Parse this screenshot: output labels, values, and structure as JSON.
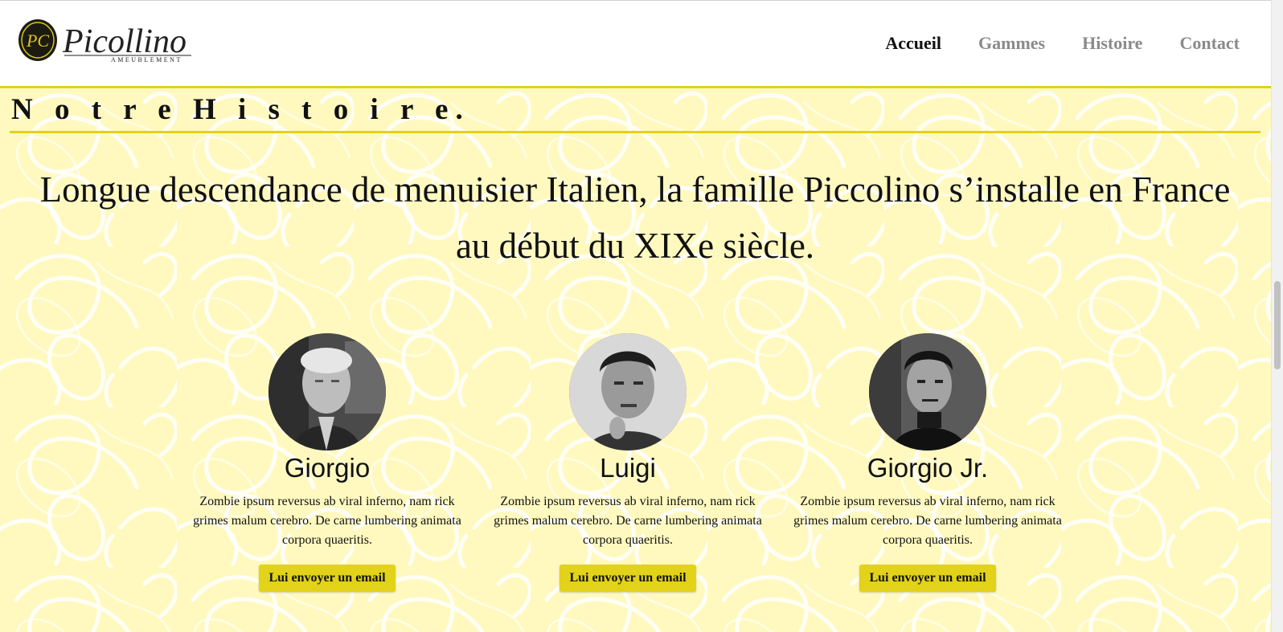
{
  "header": {
    "logo_text": "Picollino",
    "logo_subtext": "AMEUBLEMENT",
    "logo_monogram": "PC",
    "nav": [
      {
        "label": "Accueil",
        "active": true
      },
      {
        "label": "Gammes",
        "active": false
      },
      {
        "label": "Histoire",
        "active": false
      },
      {
        "label": "Contact",
        "active": false
      }
    ]
  },
  "section": {
    "title": "N o t r e H i s t o i r e.",
    "lead": "Longue descendance de menuisier Italien, la famille Piccolino s’installe en France au début du XIXe siècle."
  },
  "people": [
    {
      "name": "Giorgio",
      "bio": "Zombie ipsum reversus ab viral inferno, nam rick grimes malum cerebro. De carne lumbering animata corpora quaeritis.",
      "button": "Lui envoyer un email"
    },
    {
      "name": "Luigi",
      "bio": "Zombie ipsum reversus ab viral inferno, nam rick grimes malum cerebro. De carne lumbering animata corpora quaeritis.",
      "button": "Lui envoyer un email"
    },
    {
      "name": "Giorgio Jr.",
      "bio": "Zombie ipsum reversus ab viral inferno, nam rick grimes malum cerebro. De carne lumbering animata corpora quaeritis.",
      "button": "Lui envoyer un email"
    }
  ],
  "colors": {
    "accent": "#e2d21a",
    "background": "#fff9c0",
    "nav_active": "#111111",
    "nav_inactive": "#8a8a8a"
  }
}
